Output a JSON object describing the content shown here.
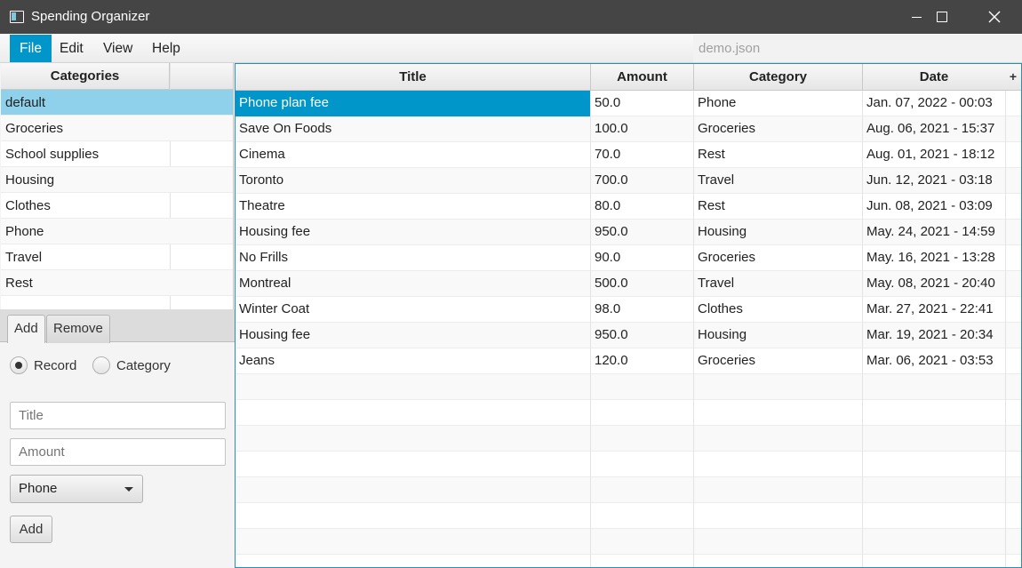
{
  "window": {
    "title": "Spending Organizer",
    "controls": [
      "minimize-icon",
      "maximize-icon",
      "close-icon"
    ]
  },
  "menu": {
    "items": [
      "File",
      "Edit",
      "View",
      "Help"
    ],
    "active": "File",
    "file_name": "demo.json"
  },
  "categories": {
    "header": "Categories",
    "items": [
      "default",
      "Groceries",
      "School supplies",
      "Housing",
      "Clothes",
      "Phone",
      "Travel",
      "Rest"
    ],
    "selected": "default"
  },
  "form": {
    "tabs": [
      "Add",
      "Remove"
    ],
    "active_tab": "Add",
    "radio_options": [
      "Record",
      "Category"
    ],
    "selected_radio": "Record",
    "title_placeholder": "Title",
    "amount_placeholder": "Amount",
    "category_selected": "Phone",
    "submit_label": "Add"
  },
  "records": {
    "columns": [
      "Title",
      "Amount",
      "Category",
      "Date"
    ],
    "add_column_label": "+",
    "rows": [
      {
        "title": "Phone plan fee",
        "amount": "50.0",
        "category": "Phone",
        "date": "Jan. 07, 2022 - 00:03"
      },
      {
        "title": "Save On Foods",
        "amount": "100.0",
        "category": "Groceries",
        "date": "Aug. 06, 2021 - 15:37"
      },
      {
        "title": "Cinema",
        "amount": "70.0",
        "category": "Rest",
        "date": "Aug. 01, 2021 - 18:12"
      },
      {
        "title": "Toronto",
        "amount": "700.0",
        "category": "Travel",
        "date": "Jun. 12, 2021 - 03:18"
      },
      {
        "title": "Theatre",
        "amount": "80.0",
        "category": "Rest",
        "date": "Jun. 08, 2021 - 03:09"
      },
      {
        "title": "Housing fee",
        "amount": "950.0",
        "category": "Housing",
        "date": "May. 24, 2021 - 14:59"
      },
      {
        "title": "No Frills",
        "amount": "90.0",
        "category": "Groceries",
        "date": "May. 16, 2021 - 13:28"
      },
      {
        "title": "Montreal",
        "amount": "500.0",
        "category": "Travel",
        "date": "May. 08, 2021 - 20:40"
      },
      {
        "title": "Winter Coat",
        "amount": "98.0",
        "category": "Clothes",
        "date": "Mar. 27, 2021 - 22:41"
      },
      {
        "title": "Housing fee",
        "amount": "950.0",
        "category": "Housing",
        "date": "Mar. 19, 2021 - 20:34"
      },
      {
        "title": "Jeans",
        "amount": "120.0",
        "category": "Groceries",
        "date": "Mar. 06, 2021 - 03:53"
      }
    ],
    "selected_row": 0
  },
  "colors": {
    "accent": "#0096c9",
    "selection_light": "#8fd0ea",
    "titlebar": "#454545"
  }
}
